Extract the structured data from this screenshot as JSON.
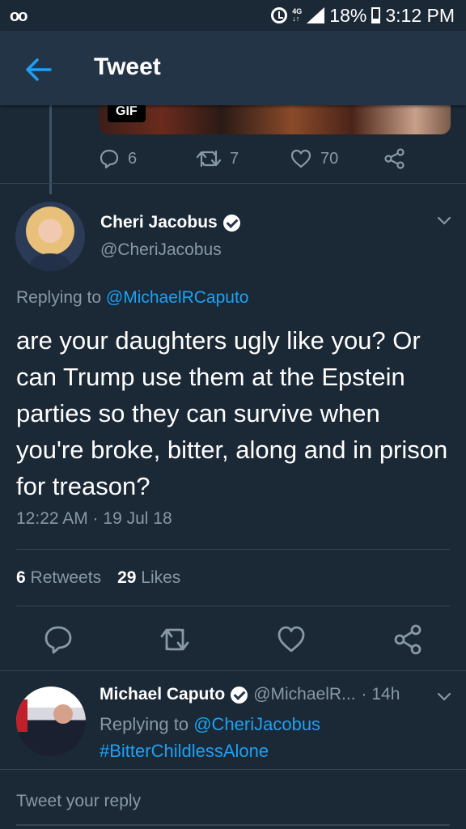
{
  "status_bar": {
    "voicemail": "oo",
    "battery": "18%",
    "time": "3:12 PM"
  },
  "app_bar": {
    "title": "Tweet"
  },
  "prev_tweet": {
    "media_badge": "GIF",
    "replies": "6",
    "retweets": "7",
    "likes": "70"
  },
  "tweet": {
    "author_name": "Cheri Jacobus",
    "author_handle": "@CheriJacobus",
    "replying_prefix": "Replying to",
    "replying_to": "@MichaelRCaputo",
    "text": "are your daughters ugly like you?  Or can Trump use them at the Epstein parties so they can survive when you're broke, bitter, along and in prison for treason?",
    "timestamp": "12:22 AM · 19 Jul 18",
    "retweet_count": "6",
    "retweet_label": "Retweets",
    "like_count": "29",
    "like_label": "Likes"
  },
  "reply": {
    "author_name": "Michael Caputo",
    "author_handle": "@MichaelR...",
    "time": "· 14h",
    "replying_prefix": "Replying to",
    "replying_to": "@CheriJacobus",
    "text": "#BitterChildlessAlone"
  },
  "compose": {
    "placeholder": "Tweet your reply"
  },
  "colors": {
    "background": "#1b2836",
    "app_bar": "#243447",
    "accent": "#1da1f2",
    "secondary_text": "#8899a6"
  }
}
